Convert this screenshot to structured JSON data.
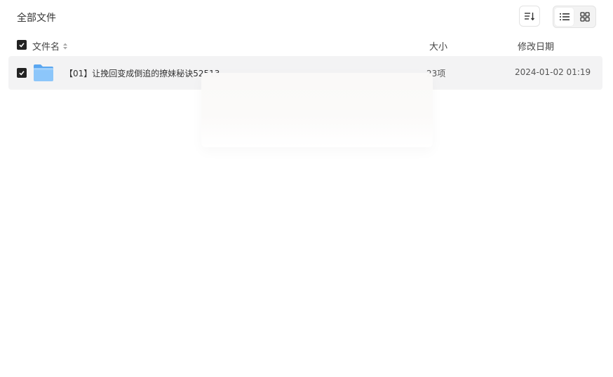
{
  "topbar": {
    "title": "全部文件",
    "sort_icon": "sort-icon",
    "list_view_icon": "list-view-icon",
    "grid_view_icon": "grid-view-icon",
    "active_view": "list"
  },
  "table": {
    "columns": {
      "name": "文件名",
      "size": "大小",
      "date": "修改日期"
    },
    "rows": [
      {
        "checked": true,
        "icon": "folder-icon",
        "name": "【01】让挽回变成倒追的撩妹秘诀52513",
        "size": "23项",
        "date": "2024-01-02 01:19"
      }
    ]
  },
  "colors": {
    "checkbox": "#222222",
    "row_bg": "#f3f3f4",
    "folder": "#7cbcf7"
  }
}
